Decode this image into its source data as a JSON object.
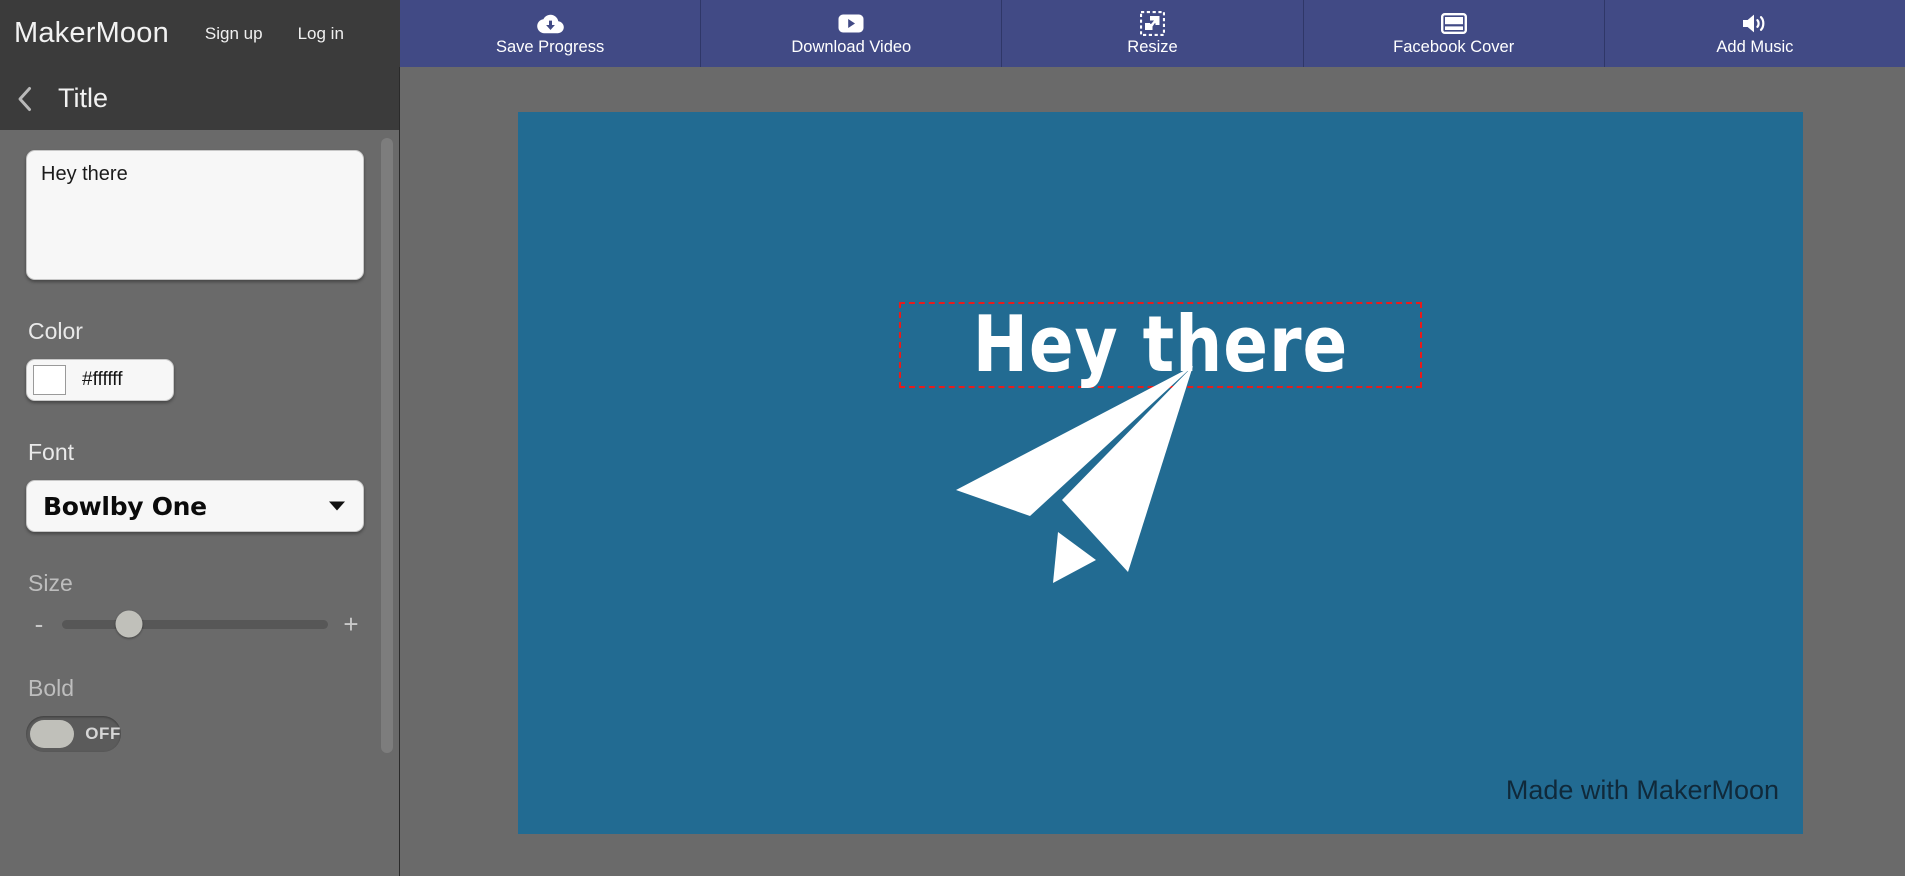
{
  "app": {
    "brand": "MakerMoon",
    "auth": [
      {
        "label": "Sign up",
        "name": "signup-link"
      },
      {
        "label": "Log in",
        "name": "login-link"
      }
    ]
  },
  "toolbar": {
    "buttons": [
      {
        "label": "Save Progress",
        "icon": "cloud-download-icon"
      },
      {
        "label": "Download Video",
        "icon": "video-play-icon"
      },
      {
        "label": "Resize",
        "icon": "resize-icon"
      },
      {
        "label": "Facebook Cover",
        "icon": "cover-layout-icon"
      },
      {
        "label": "Add Music",
        "icon": "speaker-volume-icon"
      }
    ],
    "accent": "#414a85"
  },
  "panel": {
    "title": "Title",
    "back_icon": "chevron-left-icon",
    "text_value": "Hey there",
    "color": {
      "label": "Color",
      "value": "#ffffff",
      "swatch": "#ffffff"
    },
    "font": {
      "label": "Font",
      "selected": "Bowlby One",
      "caret_icon": "chevron-down-icon"
    },
    "size": {
      "label": "Size",
      "decrease": "-",
      "increase": "+",
      "percent": 25
    },
    "bold": {
      "label": "Bold",
      "state": "OFF"
    }
  },
  "canvas": {
    "background": "#226b92",
    "headline": "Hey there",
    "headline_color": "#ffffff",
    "selection_color": "#e81b1b",
    "graphic": "paper-plane-icon",
    "watermark": "Made with MakerMoon"
  }
}
